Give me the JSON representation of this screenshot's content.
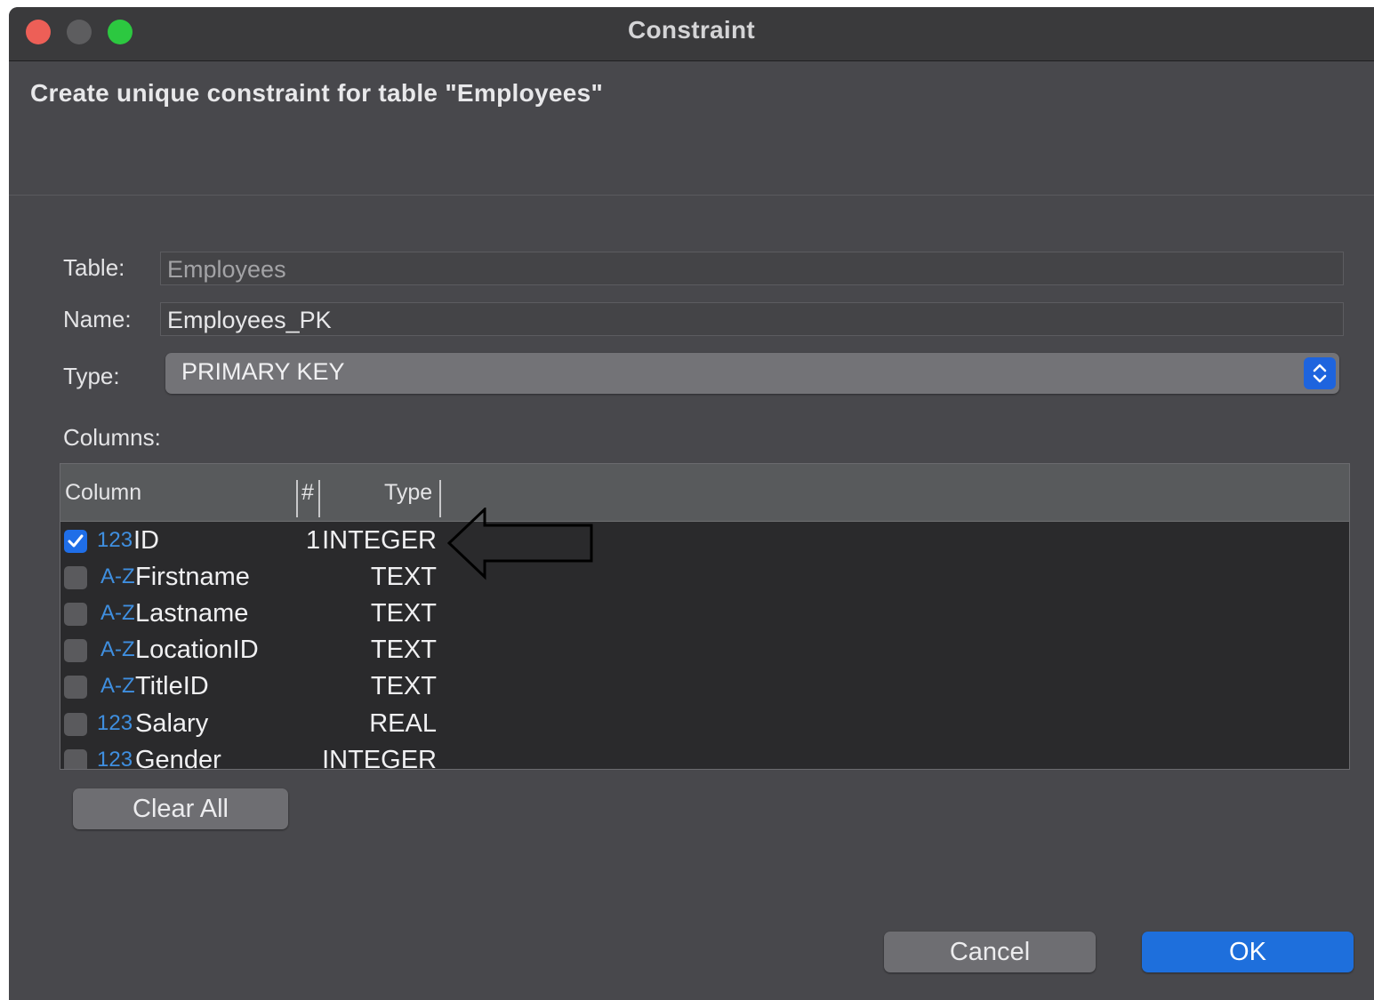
{
  "window": {
    "title": "Constraint"
  },
  "header": {
    "text": "Create unique constraint for table \"Employees\""
  },
  "form": {
    "table_label": "Table:",
    "table_value": "Employees",
    "name_label": "Name:",
    "name_value": "Employees_PK",
    "type_label": "Type:",
    "type_value": "PRIMARY KEY",
    "columns_label": "Columns:"
  },
  "columns_table": {
    "headers": {
      "column": "Column",
      "num": "#",
      "type": "Type"
    },
    "rows": [
      {
        "checked": true,
        "type_icon": "123",
        "name": "ID",
        "num": "1",
        "type": "INTEGER"
      },
      {
        "checked": false,
        "type_icon": "A-Z",
        "name": "Firstname",
        "num": "",
        "type": "TEXT"
      },
      {
        "checked": false,
        "type_icon": "A-Z",
        "name": "Lastname",
        "num": "",
        "type": "TEXT"
      },
      {
        "checked": false,
        "type_icon": "A-Z",
        "name": "LocationID",
        "num": "",
        "type": "TEXT"
      },
      {
        "checked": false,
        "type_icon": "A-Z",
        "name": "TitleID",
        "num": "",
        "type": "TEXT"
      },
      {
        "checked": false,
        "type_icon": "123",
        "name": "Salary",
        "num": "",
        "type": "REAL"
      },
      {
        "checked": false,
        "type_icon": "123",
        "name": "Gender",
        "num": "",
        "type": "INTEGER"
      }
    ]
  },
  "buttons": {
    "clear_all": "Clear All",
    "cancel": "Cancel",
    "ok": "OK"
  },
  "colors": {
    "accent": "#1e6fdc",
    "window_bg": "#48484c",
    "table_bg": "#2a2a2c"
  }
}
